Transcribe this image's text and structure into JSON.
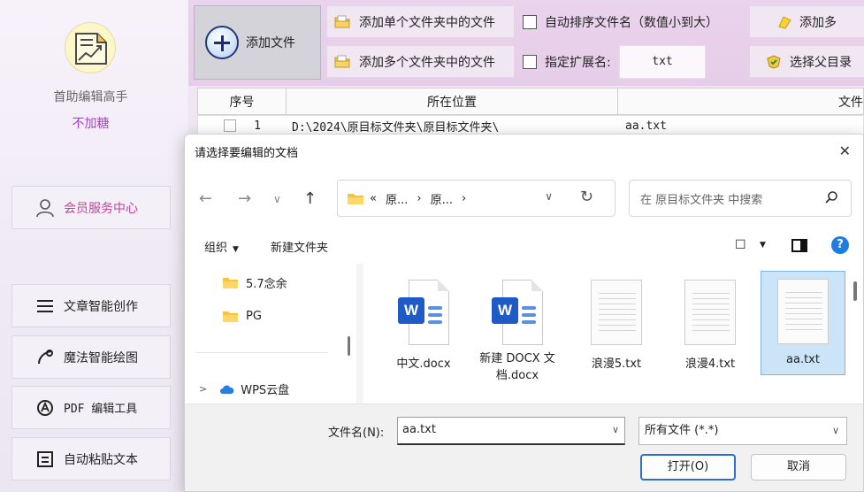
{
  "sidebar": {
    "app_name": "首助编辑高手",
    "subtitle": "不加糖",
    "member_center": "会员服务中心",
    "nav": [
      {
        "label": "文章智能创作",
        "icon": "list-icon"
      },
      {
        "label": "魔法智能绘图",
        "icon": "wand-icon"
      },
      {
        "label": "PDF 编辑工具",
        "icon": "pdf-icon"
      },
      {
        "label": "自动粘贴文本",
        "icon": "paste-icon"
      }
    ]
  },
  "toolbar": {
    "add_file": "添加文件",
    "add_single_folder": "添加单个文件夹中的文件",
    "add_multi_folder": "添加多个文件夹中的文件",
    "auto_sort": "自动排序文件名（数值小到大）",
    "ext_label": "指定扩展名:",
    "ext_value": "txt",
    "add_more": "添加多",
    "parent_dir": "选择父目录"
  },
  "table": {
    "headers": [
      "序号",
      "所在位置",
      "文件"
    ],
    "header_file_visible": "文件",
    "rows": [
      {
        "no": "1",
        "location": "D:\\2024\\原目标文件夹\\原目标文件夹\\",
        "file": "aa.txt"
      }
    ]
  },
  "dialog": {
    "title": "请选择要编辑的文档",
    "close": "✕",
    "breadcrumb": [
      "«",
      "原...",
      "›",
      "原...",
      "›"
    ],
    "search_placeholder": "在 原目标文件夹 中搜索",
    "organize": "组织",
    "new_folder": "新建文件夹",
    "tree": [
      "5.7念余",
      "PG",
      "WPS云盘"
    ],
    "files": [
      {
        "name": "中文.docx",
        "type": "docx"
      },
      {
        "name": "新建 DOCX 文档.docx",
        "type": "docx"
      },
      {
        "name": "浪漫5.txt",
        "type": "txt"
      },
      {
        "name": "浪漫4.txt",
        "type": "txt"
      },
      {
        "name": "aa.txt",
        "type": "txt",
        "selected": true
      }
    ],
    "filename_label": "文件名(N):",
    "filename_value": "aa.txt",
    "file_type": "所有文件 (*.*)",
    "open": "打开(O)",
    "cancel": "取消"
  },
  "colors": {
    "accent_purple": "#b23ad6",
    "member_pink": "#c7429a",
    "open_border": "#2d6fc8",
    "selected_file": "#cce4f7"
  }
}
